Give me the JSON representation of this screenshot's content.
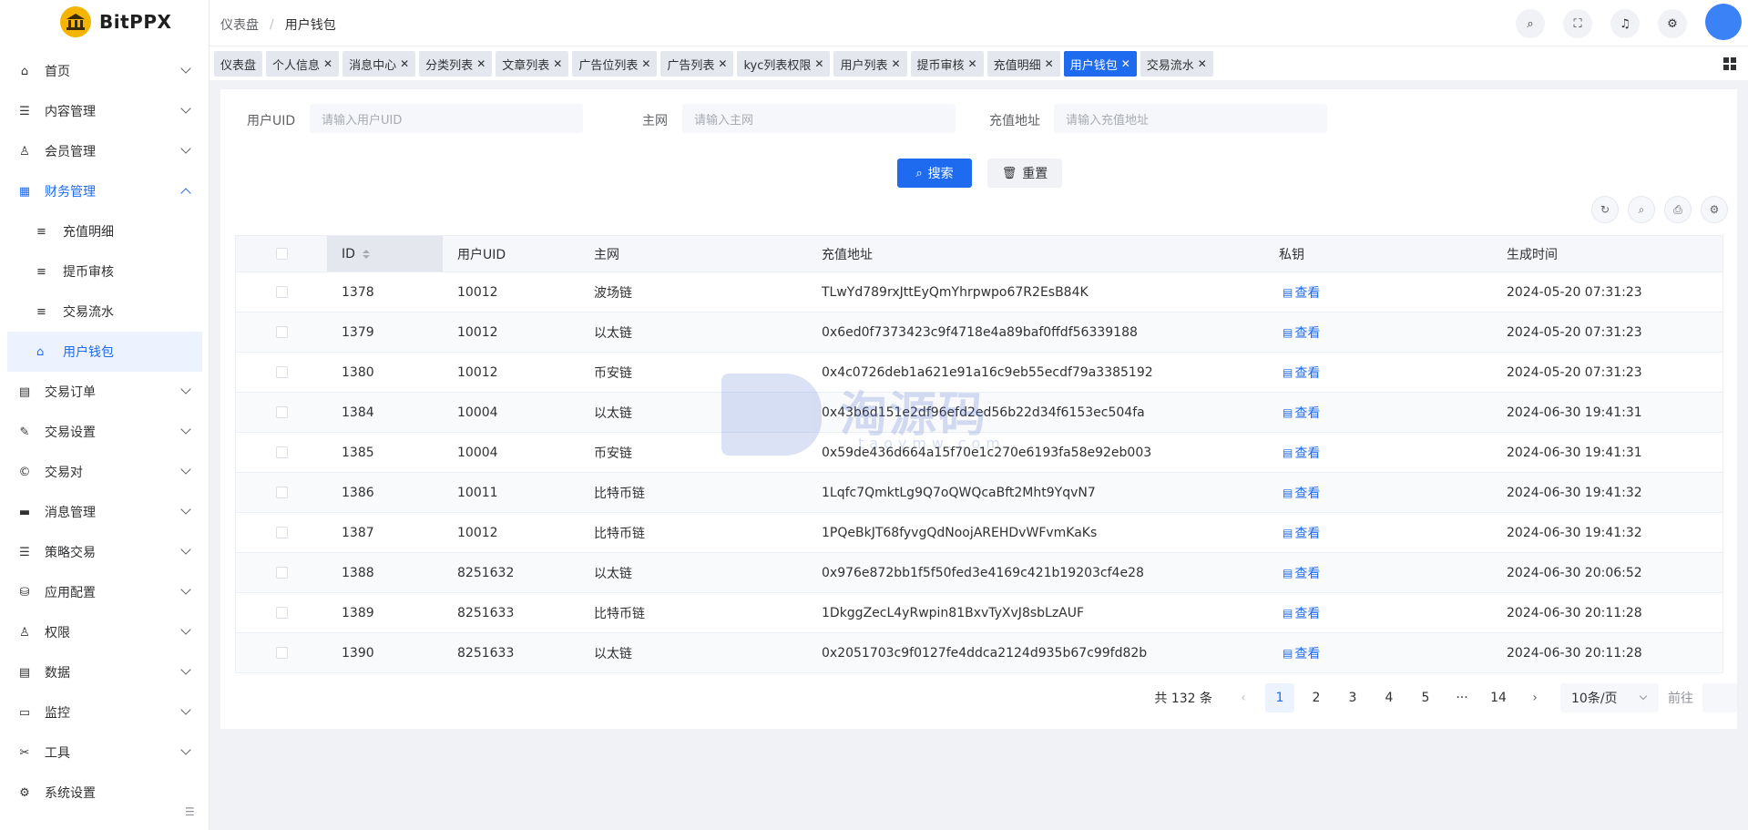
{
  "app": {
    "name": "BitPPX"
  },
  "breadcrumb": {
    "home": "仪表盘",
    "sep": "/",
    "current": "用户钱包"
  },
  "sidebar": {
    "items": [
      {
        "label": "首页",
        "icon": "home-icon",
        "glyph": "⌂"
      },
      {
        "label": "内容管理",
        "icon": "list-icon",
        "glyph": "☰"
      },
      {
        "label": "会员管理",
        "icon": "user-icon",
        "glyph": "♙"
      },
      {
        "label": "财务管理",
        "icon": "ledger-icon",
        "glyph": "▦"
      }
    ],
    "sub_items": [
      {
        "label": "充值明细",
        "icon": "list-icon",
        "glyph": "≡"
      },
      {
        "label": "提币审核",
        "icon": "list-icon",
        "glyph": "≡"
      },
      {
        "label": "交易流水",
        "icon": "align-icon",
        "glyph": "≡"
      },
      {
        "label": "用户钱包",
        "icon": "home-icon",
        "glyph": "⌂"
      }
    ],
    "items_after": [
      {
        "label": "交易订单",
        "icon": "order-icon",
        "glyph": "▤"
      },
      {
        "label": "交易设置",
        "icon": "wrench-icon",
        "glyph": "✎"
      },
      {
        "label": "交易对",
        "icon": "copyright-icon",
        "glyph": "©"
      },
      {
        "label": "消息管理",
        "icon": "message-icon",
        "glyph": "▬"
      },
      {
        "label": "策略交易",
        "icon": "menu-icon",
        "glyph": "☰"
      },
      {
        "label": "应用配置",
        "icon": "coins-icon",
        "glyph": "⛁"
      },
      {
        "label": "权限",
        "icon": "user-lock-icon",
        "glyph": "♙"
      },
      {
        "label": "数据",
        "icon": "data-icon",
        "glyph": "▤"
      },
      {
        "label": "监控",
        "icon": "monitor-icon",
        "glyph": "▭"
      },
      {
        "label": "工具",
        "icon": "scissors-icon",
        "glyph": "✂"
      },
      {
        "label": "系统设置",
        "icon": "gear-icon",
        "glyph": "⚙"
      }
    ]
  },
  "tabs": [
    {
      "label": "仪表盘",
      "closable": false
    },
    {
      "label": "个人信息",
      "closable": true
    },
    {
      "label": "消息中心",
      "closable": true
    },
    {
      "label": "分类列表",
      "closable": true
    },
    {
      "label": "文章列表",
      "closable": true
    },
    {
      "label": "广告位列表",
      "closable": true
    },
    {
      "label": "广告列表",
      "closable": true
    },
    {
      "label": "kyc列表权限",
      "closable": true
    },
    {
      "label": "用户列表",
      "closable": true
    },
    {
      "label": "提币审核",
      "closable": true
    },
    {
      "label": "充值明细",
      "closable": true
    },
    {
      "label": "用户钱包",
      "closable": true,
      "active": true
    },
    {
      "label": "交易流水",
      "closable": true
    }
  ],
  "close_glyph": "✕",
  "search_form": {
    "uid_label": "用户UID",
    "uid_placeholder": "请输入用户UID",
    "net_label": "主网",
    "net_placeholder": "请输入主网",
    "addr_label": "充值地址",
    "addr_placeholder": "请输入充值地址",
    "search_btn": "搜索",
    "reset_btn": "重置"
  },
  "table": {
    "columns": [
      "ID",
      "用户UID",
      "主网",
      "充值地址",
      "私钥",
      "生成时间"
    ],
    "view_label": "查看",
    "rows": [
      {
        "id": "1378",
        "uid": "10012",
        "net": "波场链",
        "addr": "TLwYd789rxJttEyQmYhrpwpo67R2EsB84K",
        "time": "2024-05-20 07:31:23"
      },
      {
        "id": "1379",
        "uid": "10012",
        "net": "以太链",
        "addr": "0x6ed0f7373423c9f4718e4a89baf0ffdf56339188",
        "time": "2024-05-20 07:31:23"
      },
      {
        "id": "1380",
        "uid": "10012",
        "net": "币安链",
        "addr": "0x4c0726deb1a621e91a16c9eb55ecdf79a3385192",
        "time": "2024-05-20 07:31:23"
      },
      {
        "id": "1384",
        "uid": "10004",
        "net": "以太链",
        "addr": "0x43b6d151e2df96efd2ed56b22d34f6153ec504fa",
        "time": "2024-06-30 19:41:31"
      },
      {
        "id": "1385",
        "uid": "10004",
        "net": "币安链",
        "addr": "0x59de436d664a15f70e1c270e6193fa58e92eb003",
        "time": "2024-06-30 19:41:31"
      },
      {
        "id": "1386",
        "uid": "10011",
        "net": "比特币链",
        "addr": "1Lqfc7QmktLg9Q7oQWQcaBft2Mht9YqvN7",
        "time": "2024-06-30 19:41:32"
      },
      {
        "id": "1387",
        "uid": "10012",
        "net": "比特币链",
        "addr": "1PQeBkJT68fyvgQdNoojAREHDvWFvmKaKs",
        "time": "2024-06-30 19:41:32"
      },
      {
        "id": "1388",
        "uid": "8251632",
        "net": "以太链",
        "addr": "0x976e872bb1f5f50fed3e4169c421b19203cf4e28",
        "time": "2024-06-30 20:06:52"
      },
      {
        "id": "1389",
        "uid": "8251633",
        "net": "比特币链",
        "addr": "1DkggZecL4yRwpin81BxvTyXvJ8sbLzAUF",
        "time": "2024-06-30 20:11:28"
      },
      {
        "id": "1390",
        "uid": "8251633",
        "net": "以太链",
        "addr": "0x2051703c9f0127fe4ddca2124d935b67c99fd82b",
        "time": "2024-06-30 20:11:28"
      }
    ]
  },
  "pagination": {
    "total": "共 132 条",
    "pages": [
      "1",
      "2",
      "3",
      "4",
      "5",
      "···",
      "14"
    ],
    "current": "1",
    "page_size": "10条/页",
    "goto_label": "前往"
  },
  "watermark": {
    "text": "淘源码",
    "sub": "taoymw.com"
  },
  "colors": {
    "primary": "#1e6bf0",
    "logo": "#f5b400",
    "avatar": "#3b82f6"
  }
}
